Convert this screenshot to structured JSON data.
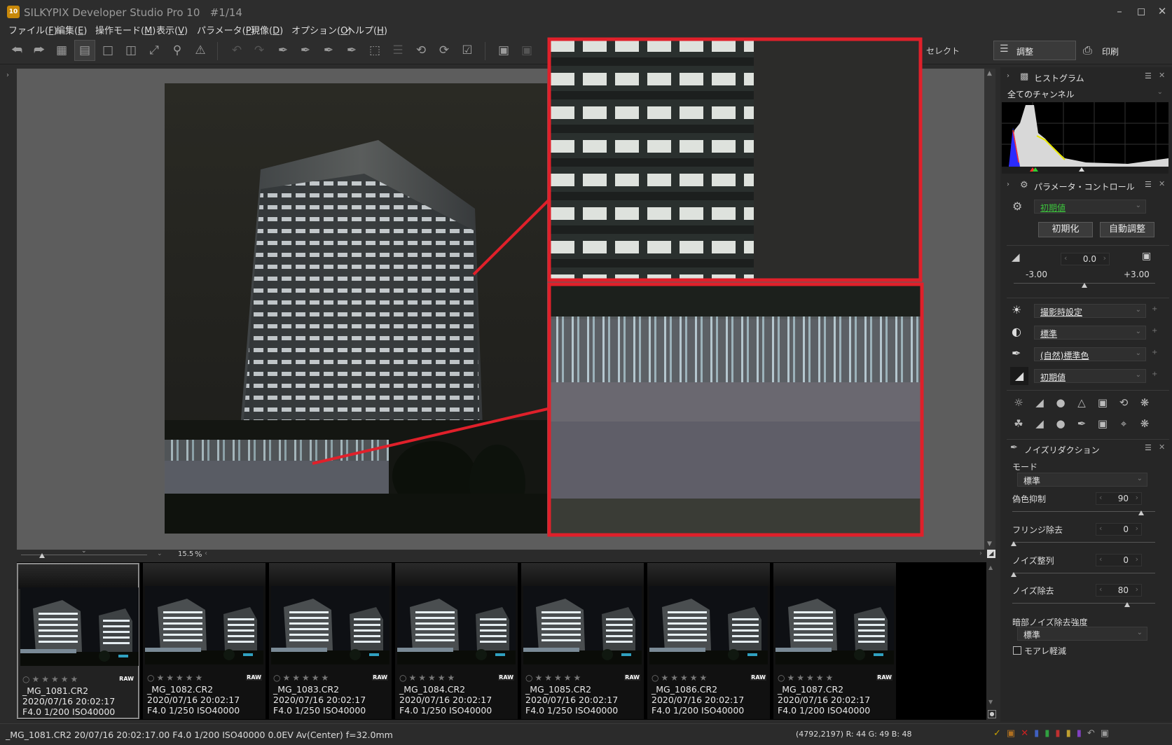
{
  "window": {
    "app_icon_text": "10",
    "title": "SILKYPIX Developer Studio Pro 10",
    "image_counter": "#1/14"
  },
  "menu": [
    {
      "label": "ファイル(",
      "key": "F",
      "end": ")"
    },
    {
      "label": "編集(",
      "key": "E",
      "end": ")"
    },
    {
      "label": "操作モード(",
      "key": "M",
      "end": ")"
    },
    {
      "label": "表示(",
      "key": "V",
      "end": ")"
    },
    {
      "label": "パラメータ(",
      "key": "P",
      "end": ")"
    },
    {
      "label": "現像(",
      "key": "D",
      "end": ")"
    },
    {
      "label": "オプション(",
      "key": "O",
      "end": ")"
    },
    {
      "label": "ヘルプ(",
      "key": "H",
      "end": ")"
    }
  ],
  "toolbar": {
    "select_label": "セレクト",
    "adjust_label": "調整",
    "print_label": "印刷"
  },
  "viewer": {
    "zoom_value": "15.5",
    "zoom_unit": "%"
  },
  "panels": {
    "histogram": {
      "title": "ヒストグラム",
      "channel": "全てのチャンネル"
    },
    "parameter_control": {
      "title": "パラメータ・コントロール",
      "preset": "初期値",
      "init_button": "初期化",
      "auto_button": "自動調整",
      "exposure_value": "0.0",
      "exposure_min": "-3.00",
      "exposure_max": "+3.00",
      "exposure_fraction": 0.5,
      "white_balance": "撮影時設定",
      "tone": "標準",
      "color": "(自然)標準色",
      "sharpness": "初期値"
    },
    "noise_reduction": {
      "title": "ノイズリダクション",
      "mode_label": "モード",
      "mode_value": "標準",
      "false_color_label": "偽色抑制",
      "false_color_value": "90",
      "false_color_max": 100,
      "fringe_label": "フリンジ除去",
      "fringe_value": "0",
      "noise_align_label": "ノイズ整列",
      "noise_align_value": "0",
      "noise_remove_label": "ノイズ除去",
      "noise_remove_value": "80",
      "dark_noise_label": "暗部ノイズ除去強度",
      "dark_noise_value": "標準",
      "moire_label": "モアレ軽減"
    }
  },
  "thumbnails": [
    {
      "file": "_MG_1081.CR2",
      "date": "2020/07/16 20:02:17",
      "exif": "F4.0 1/200 ISO40000",
      "raw": "RAW",
      "selected": true
    },
    {
      "file": "_MG_1082.CR2",
      "date": "2020/07/16 20:02:17",
      "exif": "F4.0 1/250 ISO40000",
      "raw": "RAW",
      "selected": false
    },
    {
      "file": "_MG_1083.CR2",
      "date": "2020/07/16 20:02:17",
      "exif": "F4.0 1/250 ISO40000",
      "raw": "RAW",
      "selected": false
    },
    {
      "file": "_MG_1084.CR2",
      "date": "2020/07/16 20:02:17",
      "exif": "F4.0 1/250 ISO40000",
      "raw": "RAW",
      "selected": false
    },
    {
      "file": "_MG_1085.CR2",
      "date": "2020/07/16 20:02:17",
      "exif": "F4.0 1/250 ISO40000",
      "raw": "RAW",
      "selected": false
    },
    {
      "file": "_MG_1086.CR2",
      "date": "2020/07/16 20:02:17",
      "exif": "F4.0 1/200 ISO40000",
      "raw": "RAW",
      "selected": false
    },
    {
      "file": "_MG_1087.CR2",
      "date": "2020/07/16 20:02:17",
      "exif": "F4.0 1/200 ISO40000",
      "raw": "RAW",
      "selected": false
    }
  ],
  "status": {
    "left": "_MG_1081.CR2 20/07/16 20:02:17.00 F4.0 1/200 ISO40000  0.0EV Av(Center) f=32.0mm",
    "right": "(4792,2197) R: 44 G: 49 B: 48"
  },
  "colors": {
    "callout_red": "#e0202a",
    "accent_green": "#3cc23c",
    "panel_bg": "#262626"
  }
}
